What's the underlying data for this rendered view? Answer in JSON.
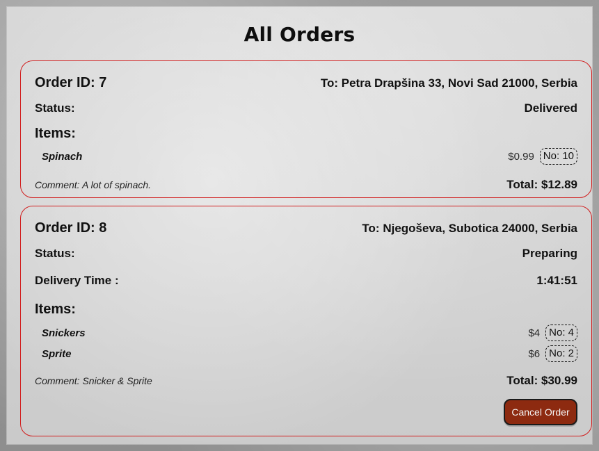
{
  "page": {
    "title": "All Orders"
  },
  "orders": [
    {
      "id_label": "Order ID: 7",
      "to_label": "To: Petra Drapšina 33, Novi Sad 21000, Serbia",
      "status_label": "Status:",
      "status_value": "Delivered",
      "items_label": "Items:",
      "items": [
        {
          "name": "Spinach",
          "price": "$0.99",
          "qty": "No: 10"
        }
      ],
      "comment": "Comment: A lot of spinach.",
      "total": "Total: $12.89"
    },
    {
      "id_label": "Order ID: 8",
      "to_label": "To: Njegoševa, Subotica 24000, Serbia",
      "status_label": "Status:",
      "status_value": "Preparing",
      "delivery_time_label": "Delivery Time :",
      "delivery_time_value": "1:41:51",
      "items_label": "Items:",
      "items": [
        {
          "name": "Snickers",
          "price": "$4",
          "qty": "No: 4"
        },
        {
          "name": "Sprite",
          "price": "$6",
          "qty": "No: 2"
        }
      ],
      "comment": "Comment: Snicker & Sprite",
      "total": "Total: $30.99",
      "cancel_label": "Cancel Order",
      "cancel_button_color": "#8d2a10"
    }
  ]
}
